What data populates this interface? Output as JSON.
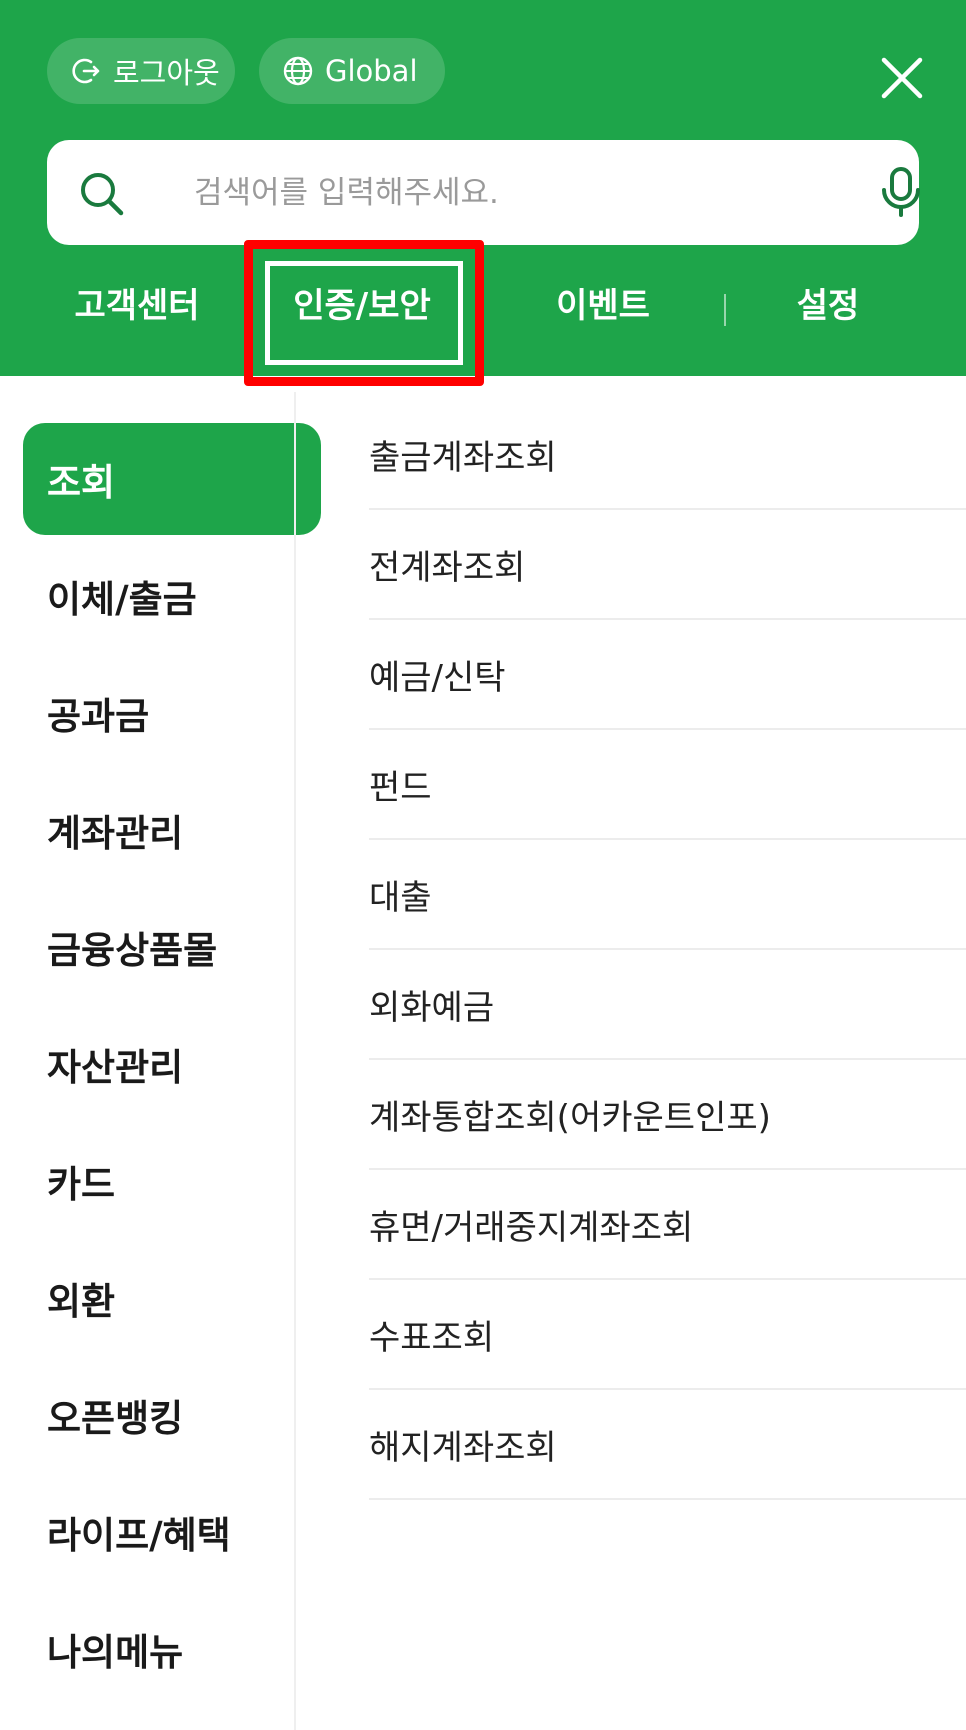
{
  "header": {
    "logout_label": "로그아웃",
    "global_label": "Global",
    "search": {
      "placeholder": "검색어를 입력해주세요."
    },
    "tabs": [
      {
        "label": "고객센터"
      },
      {
        "label": "인증/보안"
      },
      {
        "label": "이벤트"
      },
      {
        "label": "설정"
      }
    ]
  },
  "sidebar": {
    "items": [
      {
        "label": "조회",
        "active": true
      },
      {
        "label": "이체/출금"
      },
      {
        "label": "공과금"
      },
      {
        "label": "계좌관리"
      },
      {
        "label": "금융상품몰"
      },
      {
        "label": "자산관리"
      },
      {
        "label": "카드"
      },
      {
        "label": "외환"
      },
      {
        "label": "오픈뱅킹"
      },
      {
        "label": "라이프/혜택"
      },
      {
        "label": "나의메뉴"
      }
    ]
  },
  "submenu": {
    "items": [
      {
        "label": "출금계좌조회"
      },
      {
        "label": "전계좌조회"
      },
      {
        "label": "예금/신탁"
      },
      {
        "label": "펀드"
      },
      {
        "label": "대출"
      },
      {
        "label": "외화예금"
      },
      {
        "label": "계좌통합조회(어카운트인포)"
      },
      {
        "label": "휴면/거래중지계좌조회"
      },
      {
        "label": "수표조회"
      },
      {
        "label": "해지계좌조회"
      }
    ]
  },
  "colors": {
    "brand_green": "#1ea54a",
    "highlight_red": "#ff0000"
  },
  "icons": [
    "logout-icon",
    "globe-icon",
    "close-icon",
    "search-icon",
    "mic-icon"
  ]
}
